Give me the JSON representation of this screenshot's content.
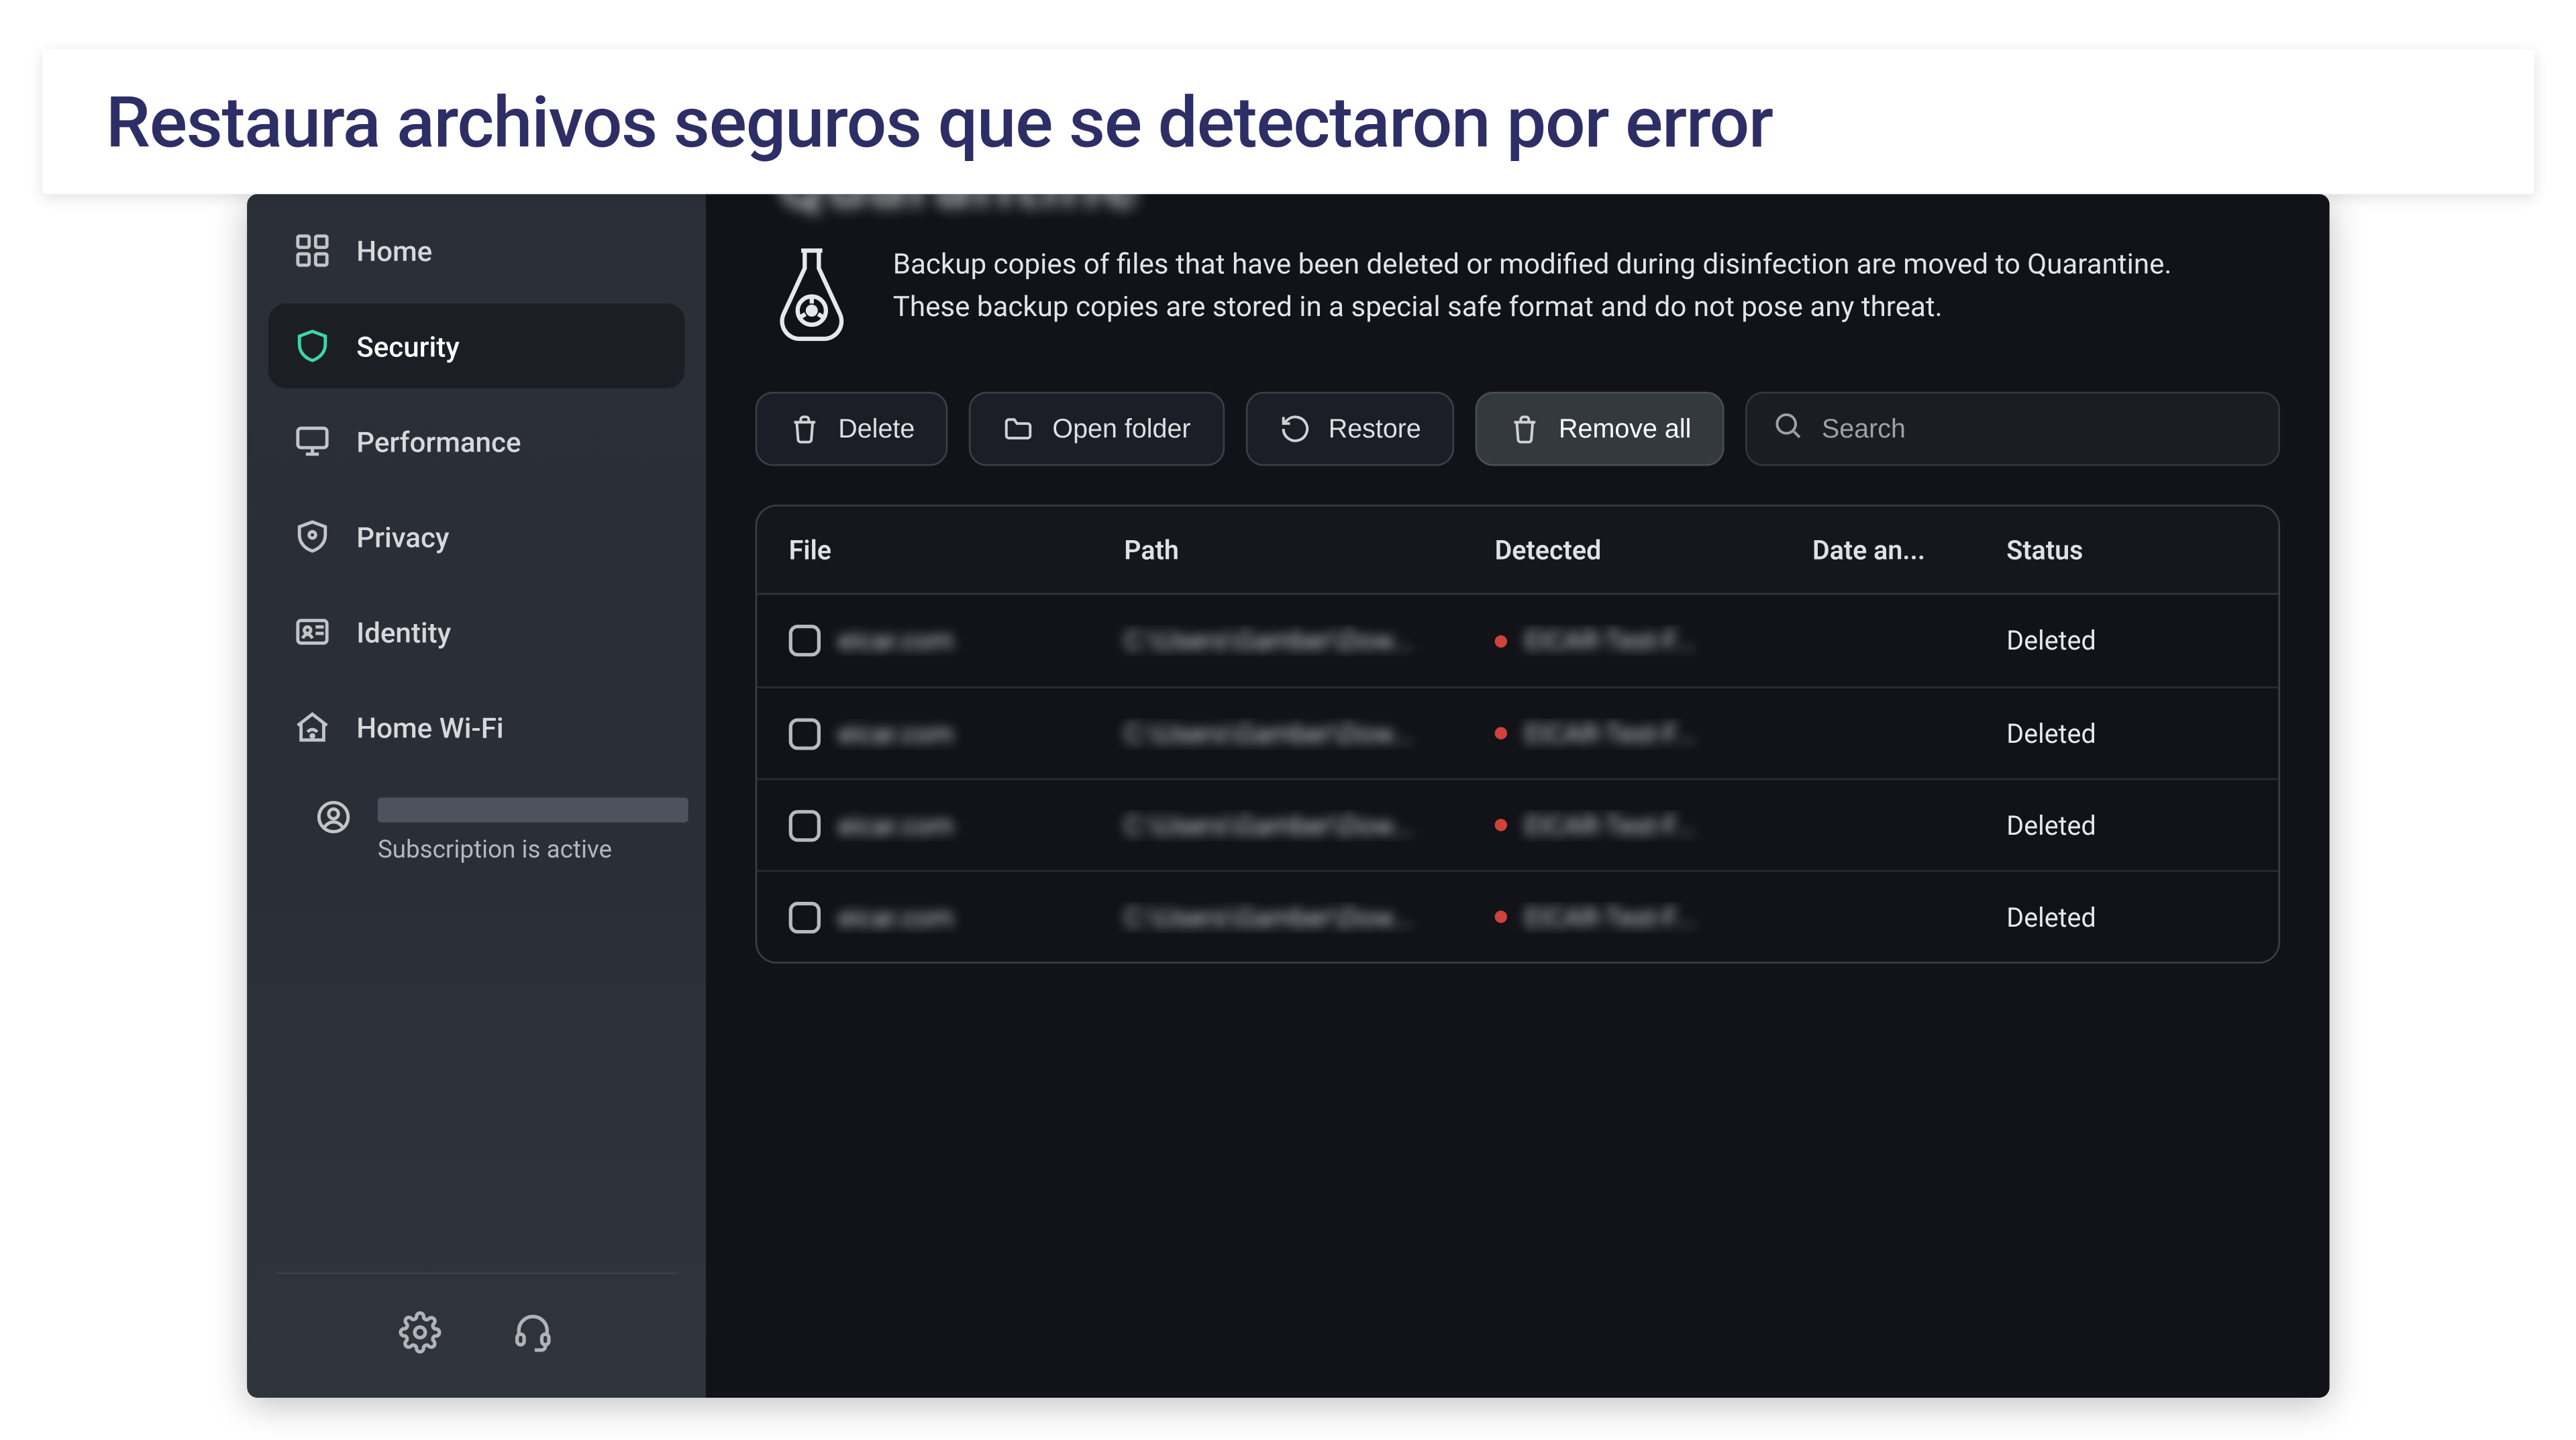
{
  "caption": "Restaura archivos seguros que se detectaron por error",
  "sidebar": {
    "items": [
      {
        "label": "Home",
        "icon": "home-grid-icon"
      },
      {
        "label": "Security",
        "icon": "shield-icon",
        "active": true
      },
      {
        "label": "Performance",
        "icon": "monitor-icon"
      },
      {
        "label": "Privacy",
        "icon": "badge-icon"
      },
      {
        "label": "Identity",
        "icon": "id-icon"
      },
      {
        "label": "Home Wi-Fi",
        "icon": "house-wifi-icon"
      }
    ],
    "subscription": "Subscription is active"
  },
  "page": {
    "title": "Quarantine",
    "description": "Backup copies of files that have been deleted or modified during disinfection are moved to Quarantine. These backup copies are stored in a special safe format and do not pose any threat."
  },
  "toolbar": {
    "delete": "Delete",
    "open_folder": "Open folder",
    "restore": "Restore",
    "remove_all": "Remove all",
    "search_placeholder": "Search"
  },
  "table": {
    "headers": {
      "file": "File",
      "path": "Path",
      "detected": "Detected",
      "date": "Date an...",
      "status": "Status"
    },
    "rows": [
      {
        "file": "eicar.com",
        "path": "C:\\Users\\Gamber\\Dow...",
        "detected": "EICAR-Test-F...",
        "date": "",
        "status": "Deleted"
      },
      {
        "file": "eicar.com",
        "path": "C:\\Users\\Gamber\\Dow...",
        "detected": "EICAR-Test-F...",
        "date": "",
        "status": "Deleted"
      },
      {
        "file": "eicar.com",
        "path": "C:\\Users\\Gamber\\Dow...",
        "detected": "EICAR-Test-F...",
        "date": "",
        "status": "Deleted"
      },
      {
        "file": "eicar.com",
        "path": "C:\\Users\\Gamber\\Dow...",
        "detected": "EICAR-Test-F...",
        "date": "",
        "status": "Deleted"
      }
    ]
  }
}
